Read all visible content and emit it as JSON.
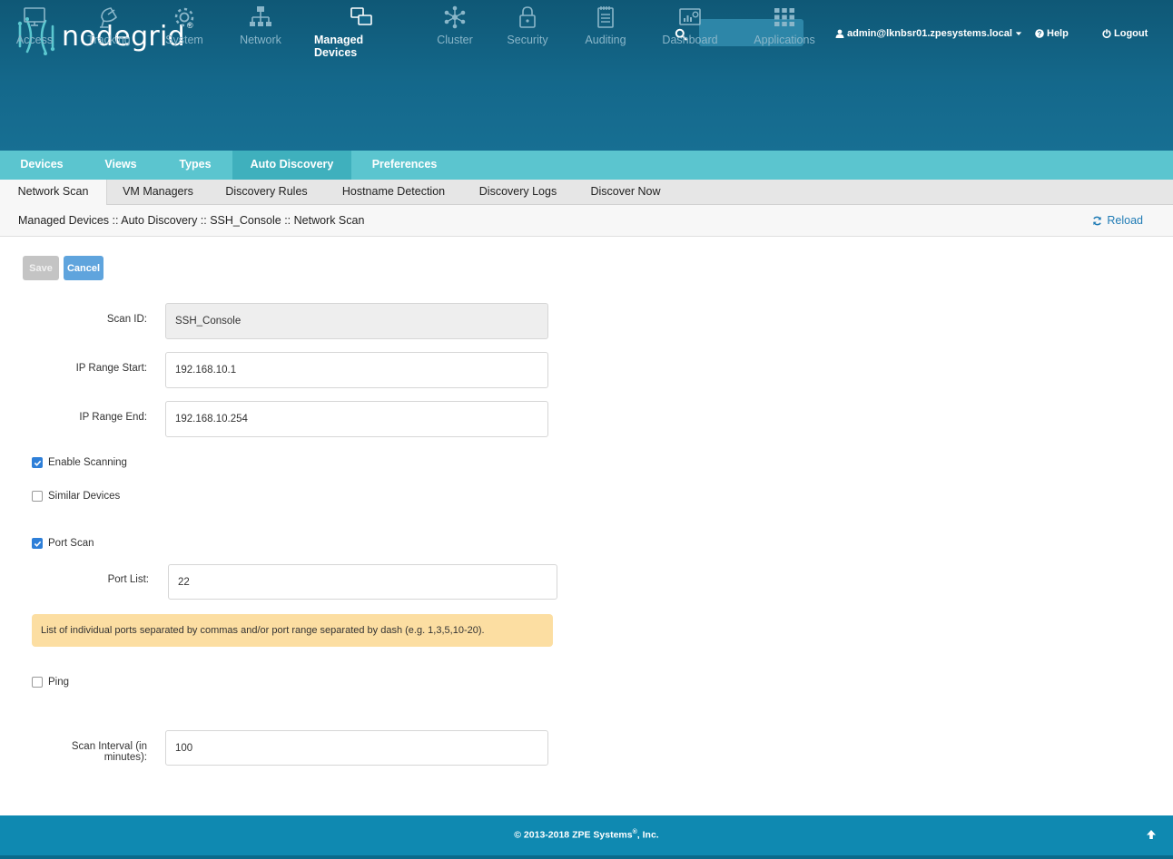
{
  "header": {
    "logo_text": "nodegrid",
    "logo_reg": "®",
    "search": {
      "placeholder": ""
    },
    "user": "admin@lknbsr01.zpesystems.local",
    "help": "Help",
    "logout": "Logout"
  },
  "main_nav": [
    {
      "label": "Access",
      "icon": "monitor-icon"
    },
    {
      "label": "Tracking",
      "icon": "satellite-icon"
    },
    {
      "label": "System",
      "icon": "gear-icon"
    },
    {
      "label": "Network",
      "icon": "network-icon"
    },
    {
      "label": "Managed Devices",
      "icon": "devices-icon",
      "active": true
    },
    {
      "label": "Cluster",
      "icon": "cluster-icon"
    },
    {
      "label": "Security",
      "icon": "lock-icon"
    },
    {
      "label": "Auditing",
      "icon": "notepad-icon"
    },
    {
      "label": "Dashboard",
      "icon": "dashboard-icon"
    },
    {
      "label": "Applications",
      "icon": "apps-grid-icon"
    }
  ],
  "sub_nav": [
    "Devices",
    "Views",
    "Types",
    "Auto Discovery",
    "Preferences"
  ],
  "tabs": [
    "Network Scan",
    "VM Managers",
    "Discovery Rules",
    "Hostname Detection",
    "Discovery Logs",
    "Discover Now"
  ],
  "breadcrumb": "Managed Devices :: Auto Discovery :: SSH_Console :: Network Scan",
  "reload": "Reload",
  "buttons": {
    "save": "Save",
    "cancel": "Cancel"
  },
  "form": {
    "scan_id": {
      "label": "Scan ID:",
      "value": "SSH_Console"
    },
    "ip_start": {
      "label": "IP Range Start:",
      "value": "192.168.10.1"
    },
    "ip_end": {
      "label": "IP Range End:",
      "value": "192.168.10.254"
    },
    "enable_scanning": {
      "label": "Enable Scanning",
      "checked": true
    },
    "similar_devices": {
      "label": "Similar Devices",
      "checked": false
    },
    "port_scan": {
      "label": "Port Scan",
      "checked": true
    },
    "port_list": {
      "label": "Port List:",
      "value": "22"
    },
    "port_hint": "List of individual ports separated by commas and/or port range separated by dash (e.g. 1,3,5,10-20).",
    "ping": {
      "label": "Ping",
      "checked": false
    },
    "scan_interval": {
      "label_line1": "Scan Interval (in",
      "label_line2": "minutes):",
      "value": "100"
    }
  },
  "footer": {
    "text_pre": "© 2013-2018 ZPE Systems",
    "text_sup": "®",
    "text_post": ", Inc."
  },
  "colors": {
    "header": "#14688b",
    "subnav": "#5bc5cf",
    "footer": "#0f89b1",
    "hint": "#fcdea2",
    "accent": "#2e7fd8"
  }
}
